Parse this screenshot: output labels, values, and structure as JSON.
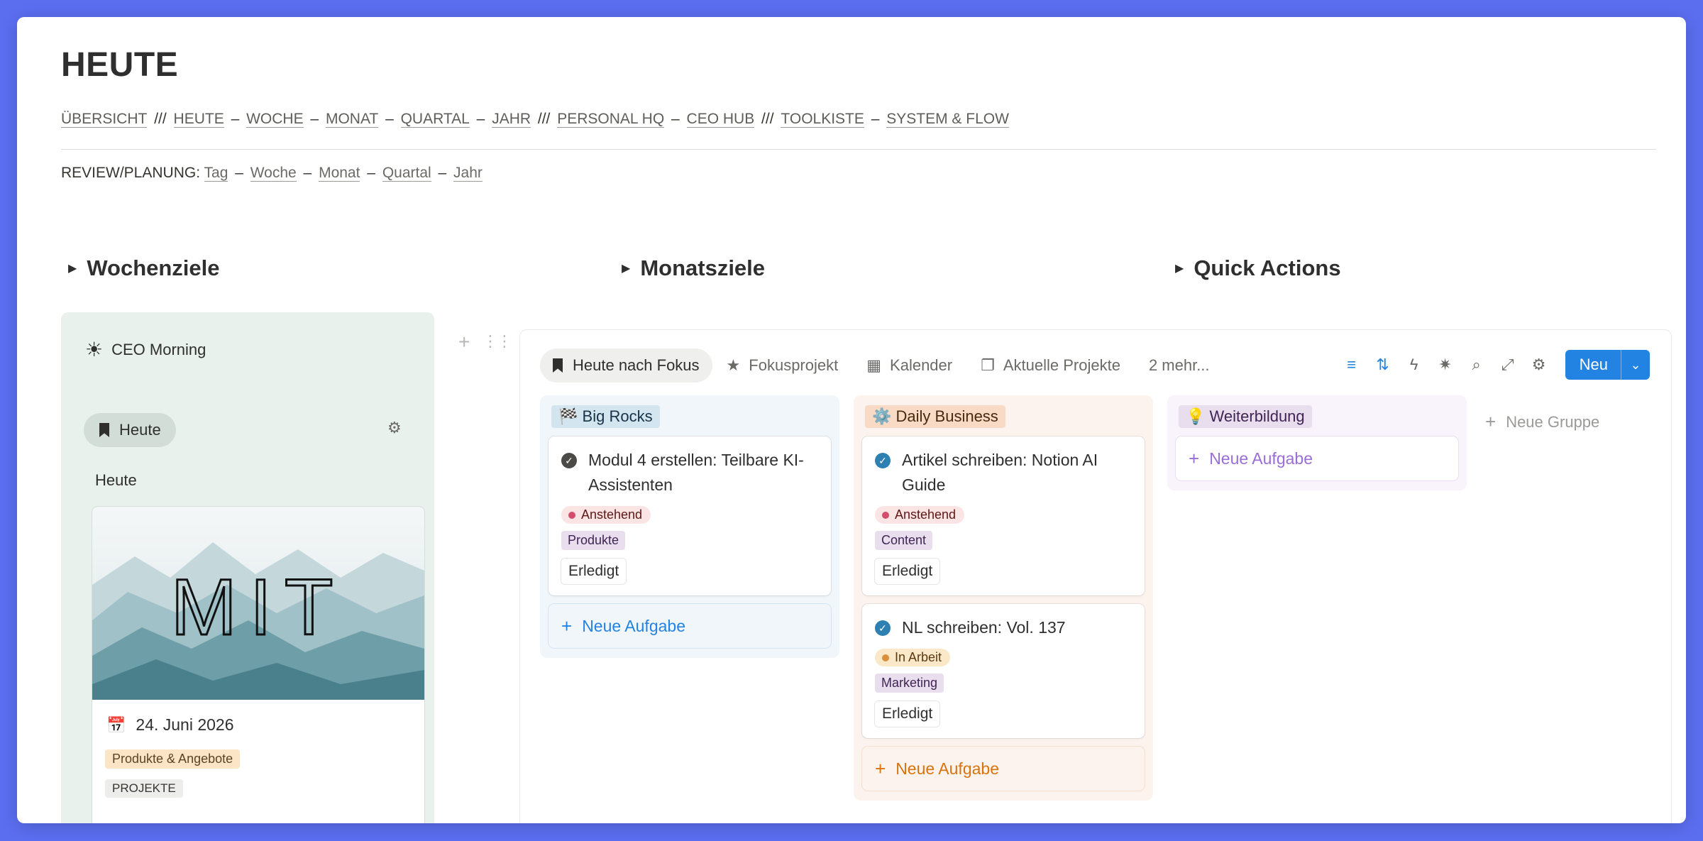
{
  "page": {
    "title": "HEUTE",
    "nav": {
      "items": [
        {
          "label": "ÜBERSICHT",
          "sep_after": " /// "
        },
        {
          "label": "HEUTE",
          "sep_after": " – "
        },
        {
          "label": "WOCHE",
          "sep_after": " – "
        },
        {
          "label": "MONAT",
          "sep_after": " – "
        },
        {
          "label": "QUARTAL",
          "sep_after": " – "
        },
        {
          "label": "JAHR",
          "sep_after": " /// "
        },
        {
          "label": "PERSONAL HQ",
          "sep_after": " – "
        },
        {
          "label": "CEO HUB",
          "sep_after": " /// "
        },
        {
          "label": "TOOLKISTE",
          "sep_after": " – "
        },
        {
          "label": "SYSTEM & FLOW",
          "sep_after": ""
        }
      ]
    },
    "review": {
      "prefix": "REVIEW/PLANUNG:",
      "items": [
        {
          "label": "Tag",
          "sep_after": " – "
        },
        {
          "label": "Woche",
          "sep_after": " – "
        },
        {
          "label": "Monat",
          "sep_after": " – "
        },
        {
          "label": "Quartal",
          "sep_after": " – "
        },
        {
          "label": "Jahr",
          "sep_after": ""
        }
      ]
    },
    "toggles": [
      "Wochenziele",
      "Monatsziele",
      "Quick Actions"
    ]
  },
  "left_panel": {
    "title": "CEO Morning",
    "tab_label": "Heute",
    "subheading": "Heute",
    "card": {
      "cover_text": "MIT",
      "date": "24. Juni 2026",
      "tag1": "Produkte & Angebote",
      "tag2": "PROJEKTE"
    }
  },
  "board": {
    "views": [
      "Heute nach Fokus",
      "Fokusprojekt",
      "Kalender",
      "Aktuelle Projekte",
      "2 mehr..."
    ],
    "new_button": "Neu",
    "new_group": "Neue Gruppe",
    "columns": [
      {
        "name": "Big Rocks",
        "emoji": "🏁",
        "cards": [
          {
            "title": "Modul 4 erstellen: Teilbare KI-Assistenten",
            "status_pill": "Anstehend",
            "tag": "Produkte",
            "done": "Erledigt"
          }
        ],
        "add_label": "Neue Aufgabe"
      },
      {
        "name": "Daily Business",
        "emoji": "⚙️",
        "cards": [
          {
            "title": "Artikel schreiben: Notion AI Guide",
            "status_pill": "Anstehend",
            "tag": "Content",
            "done": "Erledigt"
          },
          {
            "title": "NL schreiben: Vol. 137",
            "status_pill": "In Arbeit",
            "tag": "Marketing",
            "done": "Erledigt"
          }
        ],
        "add_label": "Neue Aufgabe"
      },
      {
        "name": "Weiterbildung",
        "emoji": "💡",
        "cards": [],
        "add_label": "Neue Aufgabe"
      }
    ]
  },
  "colors": {
    "accent": "#2383e2",
    "background": "#5b6ef0",
    "left_panel_bg": "#e9f1ec"
  }
}
